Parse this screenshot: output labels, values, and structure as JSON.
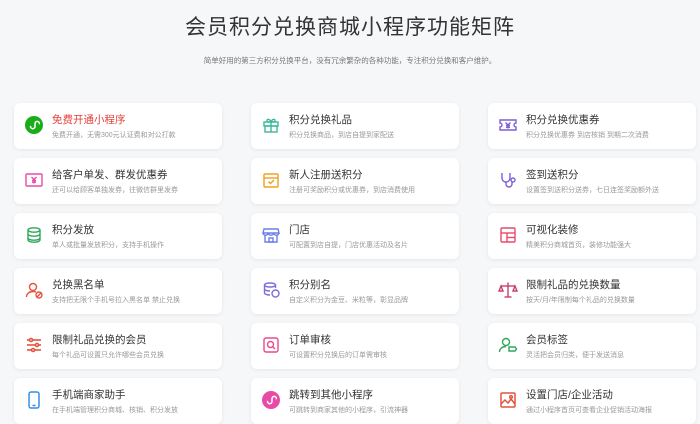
{
  "header": {
    "title": "会员积分兑换商城小程序功能矩阵",
    "subtitle": "简单好用的第三方积分兑换平台，没有冗余繁杂的各种功能，专注积分兑换和客户维护。"
  },
  "cards": [
    {
      "title": "免费开通小程序",
      "desc": "免费开通，无需300元认证费和对公打款",
      "icon": "wechat-mini-program-icon",
      "color": "#1aad19"
    },
    {
      "title": "积分兑换礼品",
      "desc": "积分兑换商品，到店自提到家配送",
      "icon": "gift-icon",
      "color": "#3bb89b"
    },
    {
      "title": "积分兑换优惠券",
      "desc": "积分兑换优惠券 到店核销 到期二次消费",
      "icon": "coupon-icon",
      "color": "#7b5fd9"
    },
    {
      "title": "给客户单发、群发优惠券",
      "desc": "还可以给顾客单独发券，往微信群里发券",
      "icon": "coupon-send-icon",
      "color": "#e84aa8"
    },
    {
      "title": "新人注册送积分",
      "desc": "注册可奖励积分或优惠券，到店消费使用",
      "icon": "new-user-gift-icon",
      "color": "#f0a020"
    },
    {
      "title": "签到送积分",
      "desc": "设置签到送积分送券，七日连签奖励额外送",
      "icon": "checkin-icon",
      "color": "#7b5fd9"
    },
    {
      "title": "积分发放",
      "desc": "单人或批量发放积分，支持手机操作",
      "icon": "points-stack-icon",
      "color": "#2fa85a"
    },
    {
      "title": "门店",
      "desc": "可配置到店自提，门店优惠活动及名片",
      "icon": "store-icon",
      "color": "#6b7ee8"
    },
    {
      "title": "可视化装修",
      "desc": "精美积分商城首页，装修功能强大",
      "icon": "layout-icon",
      "color": "#e84a6a"
    },
    {
      "title": "兑换黑名单",
      "desc": "支持把无限个手机号拉入黑名单 禁止兑换",
      "icon": "blacklist-user-icon",
      "color": "#e5533d"
    },
    {
      "title": "积分别名",
      "desc": "自定义积分为金豆、米粒等，彰显品牌",
      "icon": "coins-icon",
      "color": "#7b6fd9"
    },
    {
      "title": "限制礼品的兑换数量",
      "desc": "按天/月/年限制每个礼品的兑换数量",
      "icon": "scale-icon",
      "color": "#c8406a"
    },
    {
      "title": "限制礼品兑换的会员",
      "desc": "每个礼品可设置只允许哪些会员兑换",
      "icon": "filter-list-icon",
      "color": "#e5533d"
    },
    {
      "title": "订单审核",
      "desc": "可设置积分兑换后的订单需审核",
      "icon": "order-review-icon",
      "color": "#e84a8a"
    },
    {
      "title": "会员标签",
      "desc": "灵活把会员归类，便于发送消息",
      "icon": "member-tag-icon",
      "color": "#2fa85a"
    },
    {
      "title": "手机端商家助手",
      "desc": "在手机端管理积分商城、核销、积分发放",
      "icon": "mobile-phone-icon",
      "color": "#3a8ee6"
    },
    {
      "title": "跳转到其他小程序",
      "desc": "可跳转到商家其他的小程序，引流神器",
      "icon": "mini-program-jump-icon",
      "color": "#e84aa8"
    },
    {
      "title": "设置门店/企业活动",
      "desc": "通过小程序首页可查看企业促销活动海报",
      "icon": "activity-poster-icon",
      "color": "#e5533d"
    }
  ]
}
